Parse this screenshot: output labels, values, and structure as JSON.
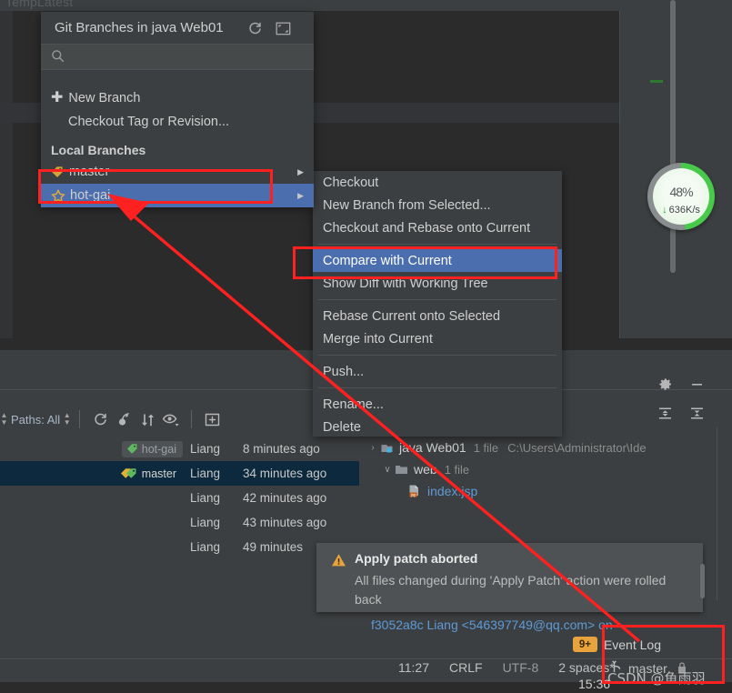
{
  "editor": {
    "cut_off_tab_label": "TempLatest"
  },
  "progress": {
    "percent": "48",
    "percent_symbol": "%",
    "rate": "636K/s",
    "down_arrow": "↓",
    "accent_color": "#49c94a"
  },
  "branch_popup": {
    "title": "Git Branches in java Web01",
    "refresh_icon": "refresh-icon",
    "expand_icon": "expand-icon",
    "search": {
      "value": "",
      "placeholder": "",
      "icon": "search-icon"
    },
    "new_branch": "New Branch",
    "checkout_tag": "Checkout Tag or Revision...",
    "local_branches_header": "Local Branches",
    "branches": [
      {
        "name": "master",
        "icon": "branch-tag-icon",
        "selected": false,
        "has_submenu": true
      },
      {
        "name": "hot-gai",
        "icon": "favorite-star-icon",
        "selected": true,
        "has_submenu": true
      }
    ]
  },
  "context_menu": {
    "groups": [
      {
        "items": [
          {
            "label": "Checkout",
            "selected": false
          },
          {
            "label": "New Branch from Selected...",
            "selected": false
          },
          {
            "label": "Checkout and Rebase onto Current",
            "selected": false
          }
        ]
      },
      {
        "items": [
          {
            "label": "Compare with Current",
            "selected": true
          },
          {
            "label": "Show Diff with Working Tree",
            "selected": false
          }
        ]
      },
      {
        "items": [
          {
            "label": "Rebase Current onto Selected",
            "selected": false
          },
          {
            "label": "Merge into Current",
            "selected": false
          }
        ]
      },
      {
        "items": [
          {
            "label": "Push...",
            "selected": false
          }
        ]
      },
      {
        "items": [
          {
            "label": "Rename...",
            "selected": false
          },
          {
            "label": "Delete",
            "selected": false
          }
        ]
      }
    ]
  },
  "log_toolbar": {
    "paths_label": "Paths: All",
    "refresh_icon": "refresh-icon",
    "cherry_pick_icon": "cherry-pick-icon",
    "sort_icon": "sort-updown-icon",
    "eye_icon": "show-details-eye-icon",
    "add_icon": "add-tab-icon"
  },
  "log_rows": [
    {
      "badge": "hot-gai",
      "badge_type": "current",
      "author": "Liang",
      "when": "8 minutes ago",
      "selected": false
    },
    {
      "badge": "master",
      "badge_type": "master",
      "author": "Liang",
      "when": "34 minutes ago",
      "selected": true
    },
    {
      "badge": "",
      "badge_type": "none",
      "author": "Liang",
      "when": "42 minutes ago",
      "selected": false
    },
    {
      "badge": "",
      "badge_type": "none",
      "author": "Liang",
      "when": "43 minutes ago",
      "selected": false
    },
    {
      "badge": "",
      "badge_type": "none",
      "author": "Liang",
      "when": "49 minutes",
      "selected": false
    }
  ],
  "tree": {
    "rows": [
      {
        "indent": 0,
        "chev": "›",
        "name": "java Web01",
        "meta": "1 file",
        "path": "C:\\Users\\Administrator\\Ide",
        "kind": "module",
        "icon": "module-icon"
      },
      {
        "indent": 1,
        "chev": "∨",
        "name": "web",
        "meta": "1 file",
        "path": "",
        "kind": "folder",
        "icon": "folder-icon"
      },
      {
        "indent": 2,
        "chev": "",
        "name": "index.jsp",
        "meta": "",
        "path": "",
        "kind": "file",
        "icon": "jsp-file-icon"
      }
    ]
  },
  "toolwindow_buttons": {
    "gear": "gear-icon",
    "minimize": "minimize-icon",
    "expand_all": "expand-all-icon",
    "collapse_all": "collapse-all-icon"
  },
  "balloon": {
    "warn_icon": "warning-icon",
    "title": "Apply patch aborted",
    "body": "All files changed during 'Apply Patch' action were rolled back"
  },
  "commit_detail": "f3052a8c Liang <546397749@qq.com> on",
  "event_log": {
    "count": "9+",
    "label": "Event Log"
  },
  "status_bar": {
    "time": "11:27",
    "line_separator": "CRLF",
    "encoding": "UTF-8",
    "indent": "2 spaces*",
    "branch": "master",
    "branch_icon": "git-branch-icon",
    "lock_icon": "lock-icon"
  },
  "clock": "15:36",
  "watermark": "CSDN @鱼雨羽",
  "annotations": {
    "box_color": "#ff2020",
    "arrow_color": "#ff2020",
    "boxes": [
      "hot-gai-branch-row",
      "compare-with-current-item",
      "status-bar-branch-area"
    ]
  }
}
